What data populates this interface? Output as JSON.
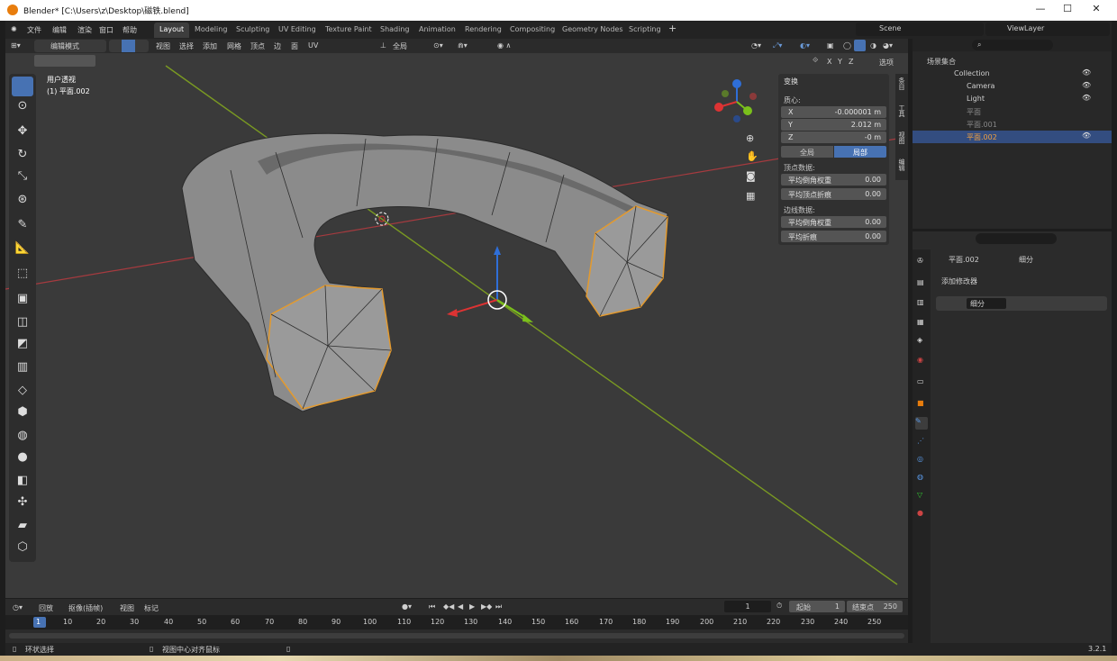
{
  "window": {
    "title": "Blender* [C:\\Users\\z\\Desktop\\磁铁.blend]"
  },
  "menu": {
    "file": "文件",
    "edit": "编辑",
    "render": "渲染",
    "window": "窗口",
    "help": "帮助"
  },
  "workspaces": [
    "Layout",
    "Modeling",
    "Sculpting",
    "UV Editing",
    "Texture Paint",
    "Shading",
    "Animation",
    "Rendering",
    "Compositing",
    "Geometry Nodes",
    "Scripting"
  ],
  "scene": {
    "name": "Scene",
    "view_layer": "ViewLayer"
  },
  "viewport_header": {
    "mode": "编辑模式",
    "view": "视图",
    "select": "选择",
    "add": "添加",
    "mesh": "网格",
    "vertex": "顶点",
    "edge": "边",
    "face": "面",
    "uv": "UV",
    "orientation": "全局",
    "options": "选项"
  },
  "viewport": {
    "view_name": "用户透视",
    "object_label": "(1) 平面.002",
    "axes": [
      "X",
      "Y",
      "Z"
    ]
  },
  "npanel": {
    "section": "变换",
    "median": "质心:",
    "x_label": "X",
    "x": "-0.000001 m",
    "y_label": "Y",
    "y": "2.012 m",
    "z_label": "Z",
    "z": "-0 m",
    "global": "全局",
    "local": "局部",
    "vertex_data": "顶点数据:",
    "bevel_weight": "平均倒角权重",
    "bevel_weight_v": "0.00",
    "vertex_crease": "平均顶点折痕",
    "vertex_crease_v": "0.00",
    "edge_data": "边线数据:",
    "edge_bevel": "平均倒角权重",
    "edge_bevel_v": "0.00",
    "edge_crease": "平均折痕",
    "edge_crease_v": "0.00",
    "tabs": [
      "条目",
      "工具",
      "视图",
      "编辑"
    ]
  },
  "outliner": {
    "root": "场景集合",
    "items": [
      {
        "name": "Collection"
      },
      {
        "name": "Camera"
      },
      {
        "name": "Light"
      },
      {
        "name": "平面"
      },
      {
        "name": "平面.001"
      },
      {
        "name": "平面.002"
      }
    ]
  },
  "properties": {
    "object": "平面.002",
    "modifier_path": "细分",
    "add_modifier": "添加修改器",
    "modifier_name": "细分"
  },
  "timeline": {
    "playback": "回放",
    "keying": "抠像(插帧)",
    "view": "视图",
    "marker": "标记",
    "current": "1",
    "start_label": "起始",
    "start": "1",
    "end_label": "结束点",
    "end": "250",
    "ticks": [
      "1",
      "10",
      "20",
      "30",
      "40",
      "50",
      "60",
      "70",
      "80",
      "90",
      "100",
      "110",
      "120",
      "130",
      "140",
      "150",
      "160",
      "170",
      "180",
      "190",
      "200",
      "210",
      "220",
      "230",
      "240",
      "250"
    ]
  },
  "status": {
    "left": "环状选择",
    "mid": "视图中心对齐鼠标",
    "version": "3.2.1"
  }
}
